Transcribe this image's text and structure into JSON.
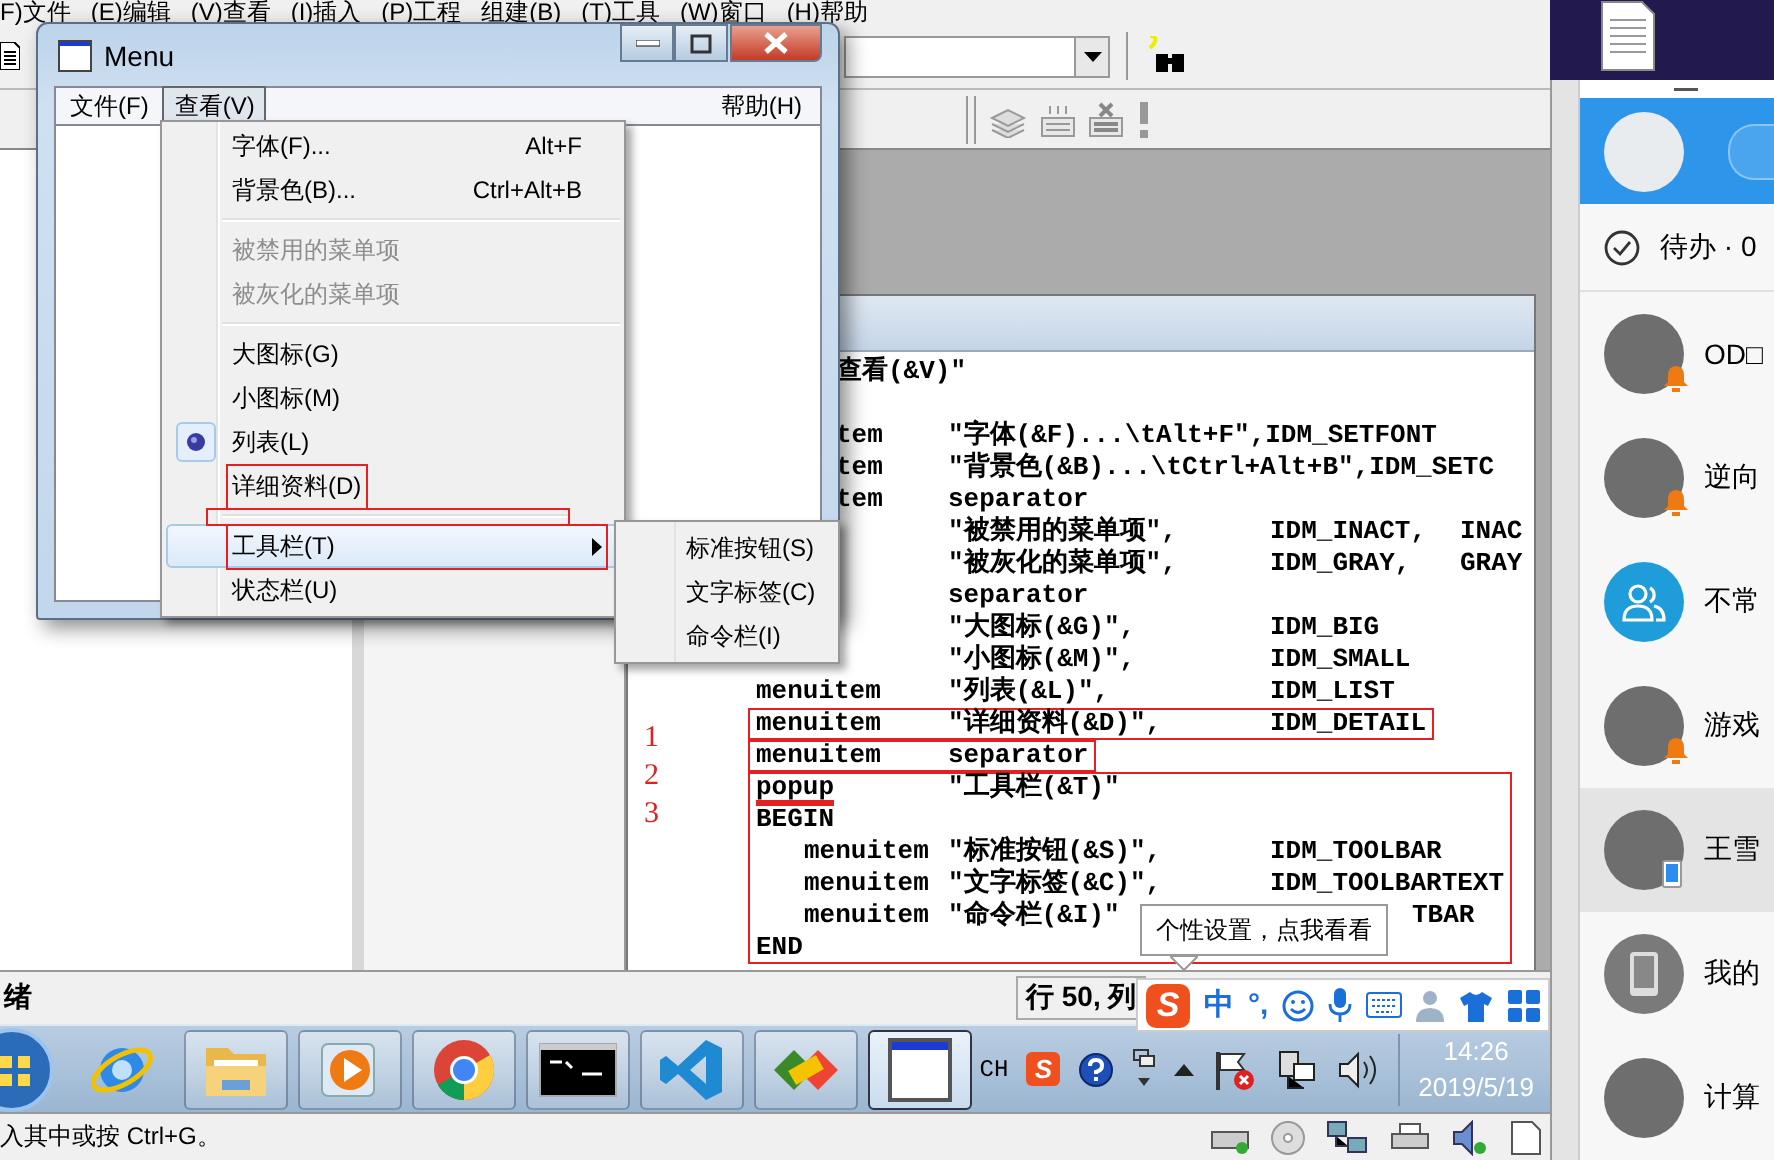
{
  "ide": {
    "menu": [
      "F)文件",
      "(E)编辑",
      "(V)查看",
      "(I)插入",
      "(P)工程",
      "组建(B)",
      "(T)工具",
      "(W)窗口",
      "(H)帮助"
    ],
    "status": "绪",
    "position": "行 50, 列",
    "hint": "入其中或按 Ctrl+G。"
  },
  "menu_window": {
    "title": "Menu",
    "menubar": [
      {
        "label": "文件(F)",
        "selected": false
      },
      {
        "label": "查看(V)",
        "selected": true
      },
      {
        "label": "帮助(H)",
        "selected": false
      }
    ],
    "dropdown": [
      {
        "kind": "item",
        "label": "字体(F)...",
        "shortcut": "Alt+F",
        "disabled": false,
        "checked": false,
        "highlighted": false,
        "annotated": false,
        "has_submenu": false
      },
      {
        "kind": "item",
        "label": "背景色(B)...",
        "shortcut": "Ctrl+Alt+B",
        "disabled": false,
        "checked": false,
        "highlighted": false,
        "annotated": false,
        "has_submenu": false
      },
      {
        "kind": "separator",
        "annotated": false
      },
      {
        "kind": "item",
        "label": "被禁用的菜单项",
        "disabled": true,
        "checked": false,
        "highlighted": false,
        "annotated": false,
        "has_submenu": false
      },
      {
        "kind": "item",
        "label": "被灰化的菜单项",
        "disabled": true,
        "checked": false,
        "highlighted": false,
        "annotated": false,
        "has_submenu": false
      },
      {
        "kind": "separator",
        "annotated": false
      },
      {
        "kind": "item",
        "label": "大图标(G)",
        "disabled": false,
        "checked": false,
        "highlighted": false,
        "annotated": false,
        "has_submenu": false
      },
      {
        "kind": "item",
        "label": "小图标(M)",
        "disabled": false,
        "checked": false,
        "highlighted": false,
        "annotated": false,
        "has_submenu": false
      },
      {
        "kind": "item",
        "label": "列表(L)",
        "disabled": false,
        "checked": true,
        "highlighted": false,
        "annotated": false,
        "has_submenu": false
      },
      {
        "kind": "item",
        "label": "详细资料(D)",
        "disabled": false,
        "checked": false,
        "highlighted": false,
        "annotated": true,
        "has_submenu": false
      },
      {
        "kind": "separator",
        "annotated": true
      },
      {
        "kind": "item",
        "label": "工具栏(T)",
        "disabled": false,
        "checked": false,
        "highlighted": true,
        "annotated": true,
        "has_submenu": true
      },
      {
        "kind": "item",
        "label": "状态栏(U)",
        "disabled": false,
        "checked": false,
        "highlighted": false,
        "annotated": false,
        "has_submenu": false
      }
    ],
    "submenu": [
      "标准按钮(S)",
      "文字标签(C)",
      "命令栏(I)"
    ]
  },
  "editor": {
    "markers": [
      "1",
      "2",
      "3"
    ],
    "blocks": [
      {
        "annotated": false,
        "lines": [
          {
            "kind": "clipped",
            "keyword": "查看(&V)\"",
            "underlined": false
          },
          {
            "kind": "blank"
          },
          {
            "kind": "clipped",
            "keyword": "tem",
            "underlined": false,
            "text": "\"字体(&F)...\\tAlt+F\",IDM_SETFONT"
          },
          {
            "kind": "clipped",
            "keyword": "tem",
            "underlined": false,
            "text": "\"背景色(&B)...\\tCtrl+Alt+B\",IDM_SETC"
          },
          {
            "kind": "clipped",
            "keyword": "tem",
            "underlined": false,
            "text": "separator"
          },
          {
            "kind": "code",
            "text": "\"被禁用的菜单项\",",
            "id": "IDM_INACT,",
            "extra": "INAC"
          },
          {
            "kind": "code",
            "text": "\"被灰化的菜单项\",",
            "id": "IDM_GRAY,",
            "extra": "GRAY"
          },
          {
            "kind": "code",
            "text": "separator"
          },
          {
            "kind": "code",
            "text": "\"大图标(&G)\",",
            "id": "IDM_BIG"
          },
          {
            "kind": "code",
            "text": "\"小图标(&M)\",",
            "id": "IDM_SMALL"
          },
          {
            "kind": "code",
            "keyword": "menuitem",
            "underlined": false,
            "text": "\"列表(&L)\",",
            "id": "IDM_LIST"
          }
        ]
      },
      {
        "annotated": true,
        "lines": [
          {
            "kind": "code",
            "keyword": "menuitem",
            "underlined": false,
            "text": "\"详细资料(&D)\",",
            "id": "IDM_DETAIL"
          }
        ]
      },
      {
        "annotated": true,
        "lines": [
          {
            "kind": "code",
            "keyword": "menuitem",
            "underlined": false,
            "text": "separator"
          }
        ]
      },
      {
        "annotated": true,
        "lines": [
          {
            "kind": "code",
            "keyword": "popup",
            "underlined": true,
            "text": "\"工具栏(&T)\""
          },
          {
            "kind": "code",
            "keyword": "BEGIN",
            "underlined": false
          },
          {
            "kind": "nested",
            "keyword": "menuitem",
            "underlined": false,
            "text": "\"标准按钮(&S)\",",
            "id": "IDM_TOOLBAR"
          },
          {
            "kind": "nested",
            "keyword": "menuitem",
            "underlined": false,
            "text": "\"文字标签(&C)\",",
            "id": "IDM_TOOLBARTEXT"
          },
          {
            "kind": "nested",
            "keyword": "menuitem",
            "underlined": false,
            "text": "\"命令栏(&I)\"",
            "id": "TBAR",
            "id_clipped": true
          },
          {
            "kind": "code",
            "keyword": "END",
            "underlined": false
          }
        ]
      }
    ]
  },
  "tooltip": "个性设置，点我看看",
  "ime": {
    "logo": "S",
    "mode": "中",
    "punct": "°,"
  },
  "taskbar": {
    "apps": [
      {
        "kind": "ie",
        "running": false,
        "active": false
      },
      {
        "kind": "folder",
        "running": true,
        "active": false
      },
      {
        "kind": "media",
        "running": true,
        "active": false
      },
      {
        "kind": "chrome",
        "running": true,
        "active": false
      },
      {
        "kind": "console",
        "running": true,
        "active": false
      },
      {
        "kind": "vscode",
        "running": true,
        "active": false
      },
      {
        "kind": "diamond",
        "running": true,
        "active": false
      },
      {
        "kind": "window",
        "running": true,
        "active": true
      }
    ],
    "tray": {
      "lang": "CH",
      "logo": "S",
      "time": "14:26",
      "date": "2019/5/19"
    }
  },
  "qq": {
    "todo": "待办 · 0",
    "contacts": [
      {
        "name": "OD□",
        "kind": "photo",
        "badge": {
          "kind": "bell"
        },
        "selected": false
      },
      {
        "name": "逆向",
        "kind": "photo",
        "badge": {
          "kind": "bell"
        },
        "selected": false
      },
      {
        "name": "不常",
        "kind": "group",
        "selected": false
      },
      {
        "name": "游戏",
        "kind": "photo",
        "badge": {
          "kind": "bell"
        },
        "selected": false
      },
      {
        "name": "王雪",
        "kind": "photo",
        "badge": {
          "kind": "phone"
        },
        "selected": true
      },
      {
        "name": "我的",
        "kind": "device",
        "selected": false
      },
      {
        "name": "计算",
        "kind": "photo",
        "selected": false
      }
    ]
  }
}
